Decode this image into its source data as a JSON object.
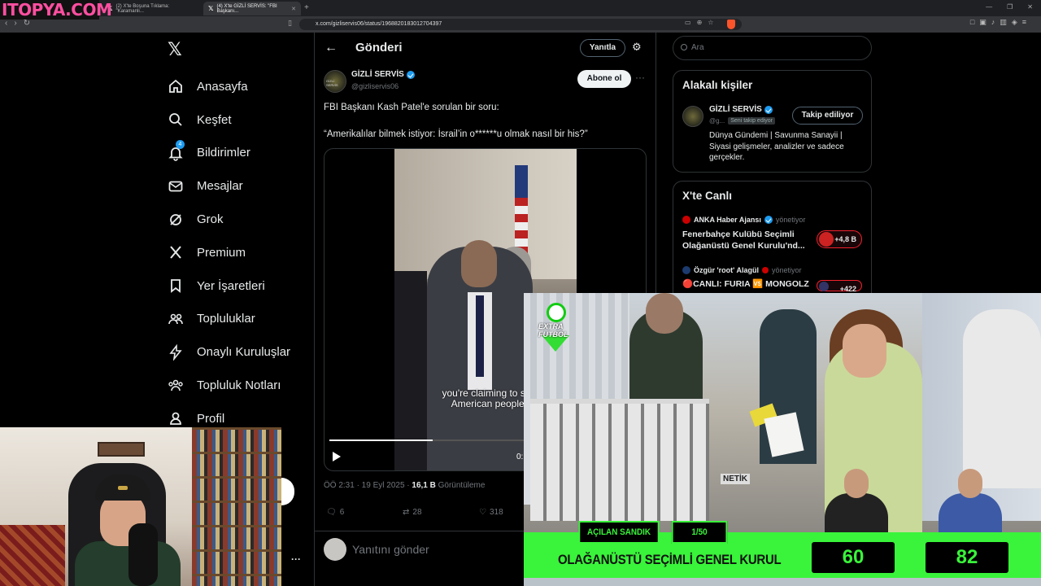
{
  "browser": {
    "brand": "ITOPYA.COM",
    "tabs": [
      {
        "label": "(2) X'te Boşuna Tıklama: \"Karamanlı..."
      },
      {
        "label": "(4) X'te GİZLİ SERVİS: \"FBI Başkanı..."
      }
    ],
    "url": "x.com/gizliservis06/status/1968820183012704397"
  },
  "nav": {
    "items": [
      {
        "label": "Anasayfa",
        "icon": "home-icon"
      },
      {
        "label": "Keşfet",
        "icon": "search-icon"
      },
      {
        "label": "Bildirimler",
        "icon": "bell-icon",
        "badge": "4"
      },
      {
        "label": "Mesajlar",
        "icon": "mail-icon"
      },
      {
        "label": "Grok",
        "icon": "grok-icon"
      },
      {
        "label": "Premium",
        "icon": "x-premium-icon"
      },
      {
        "label": "Yer İşaretleri",
        "icon": "bookmark-icon"
      },
      {
        "label": "Topluluklar",
        "icon": "communities-icon"
      },
      {
        "label": "Onaylı Kuruluşlar",
        "icon": "lightning-icon"
      },
      {
        "label": "Topluluk Notları",
        "icon": "notes-icon"
      },
      {
        "label": "Profil",
        "icon": "profile-icon"
      }
    ]
  },
  "header": {
    "title": "Gönderi",
    "reply_label": "Yanıtla"
  },
  "post": {
    "avatar_text": "GİZLİ SERVİS",
    "author": "GİZLİ SERVİS",
    "handle": "@gizliservis06",
    "follow_label": "Abone ol",
    "text1": "FBI Başkanı Kash Patel'e sorulan bir soru:",
    "text2": "“Amerikalılar bilmek istiyor: İsrail’in o******u olmak nasıl bir his?”",
    "subtitle_line1": "you're claiming to serv",
    "subtitle_line2": "American people?",
    "video_time": "0:",
    "progress": 0.33,
    "time": "ÖÖ 2:31 · 19 Eyl 2025 · ",
    "views": "16,1 B",
    "views_label": " Görüntüleme",
    "replies": "6",
    "reposts": "28",
    "likes": "318",
    "compose_placeholder": "Yanıtını gönder"
  },
  "right": {
    "search_placeholder": "Ara",
    "related_title": "Alakalı kişiler",
    "person": {
      "name": "GİZLİ SERVİS",
      "handle": "@g...",
      "follows_you": "Seni takip ediyor",
      "follow_label": "Takip ediliyor",
      "bio": "Dünya Gündemi | Savunma Sanayii | Siyasi gelişmeler, analizler ve sadece gerçekler."
    },
    "live_title": "X'te Canlı",
    "live": [
      {
        "host": "ANKA Haber Ajansı",
        "role": "yönetiyor",
        "title": "Fenerbahçe Kulübü Seçimli Olağanüstü Genel Kurulu'nd...",
        "count": "+4,8 B"
      },
      {
        "host": "Özgür 'root' Alagül",
        "role": "yönetiyor",
        "title": "🔴CANLI: FURIA 🆚 MONGOLZ",
        "count": "+422"
      }
    ]
  },
  "overlay": {
    "logo_line1": "EXTRA",
    "logo_line2": "FUTBOL",
    "label_left": "AÇILAN SANDIK",
    "label_right": "1/50",
    "title": "OLAĞANÜSTÜ SEÇİMLİ GENEL KURUL",
    "score_left": "60",
    "score_right": "82",
    "sign": "NETİK"
  },
  "colors": {
    "accent": "#1d9bf0",
    "overlay_green": "#39f43a",
    "brand_pink": "#ff4fa0"
  }
}
